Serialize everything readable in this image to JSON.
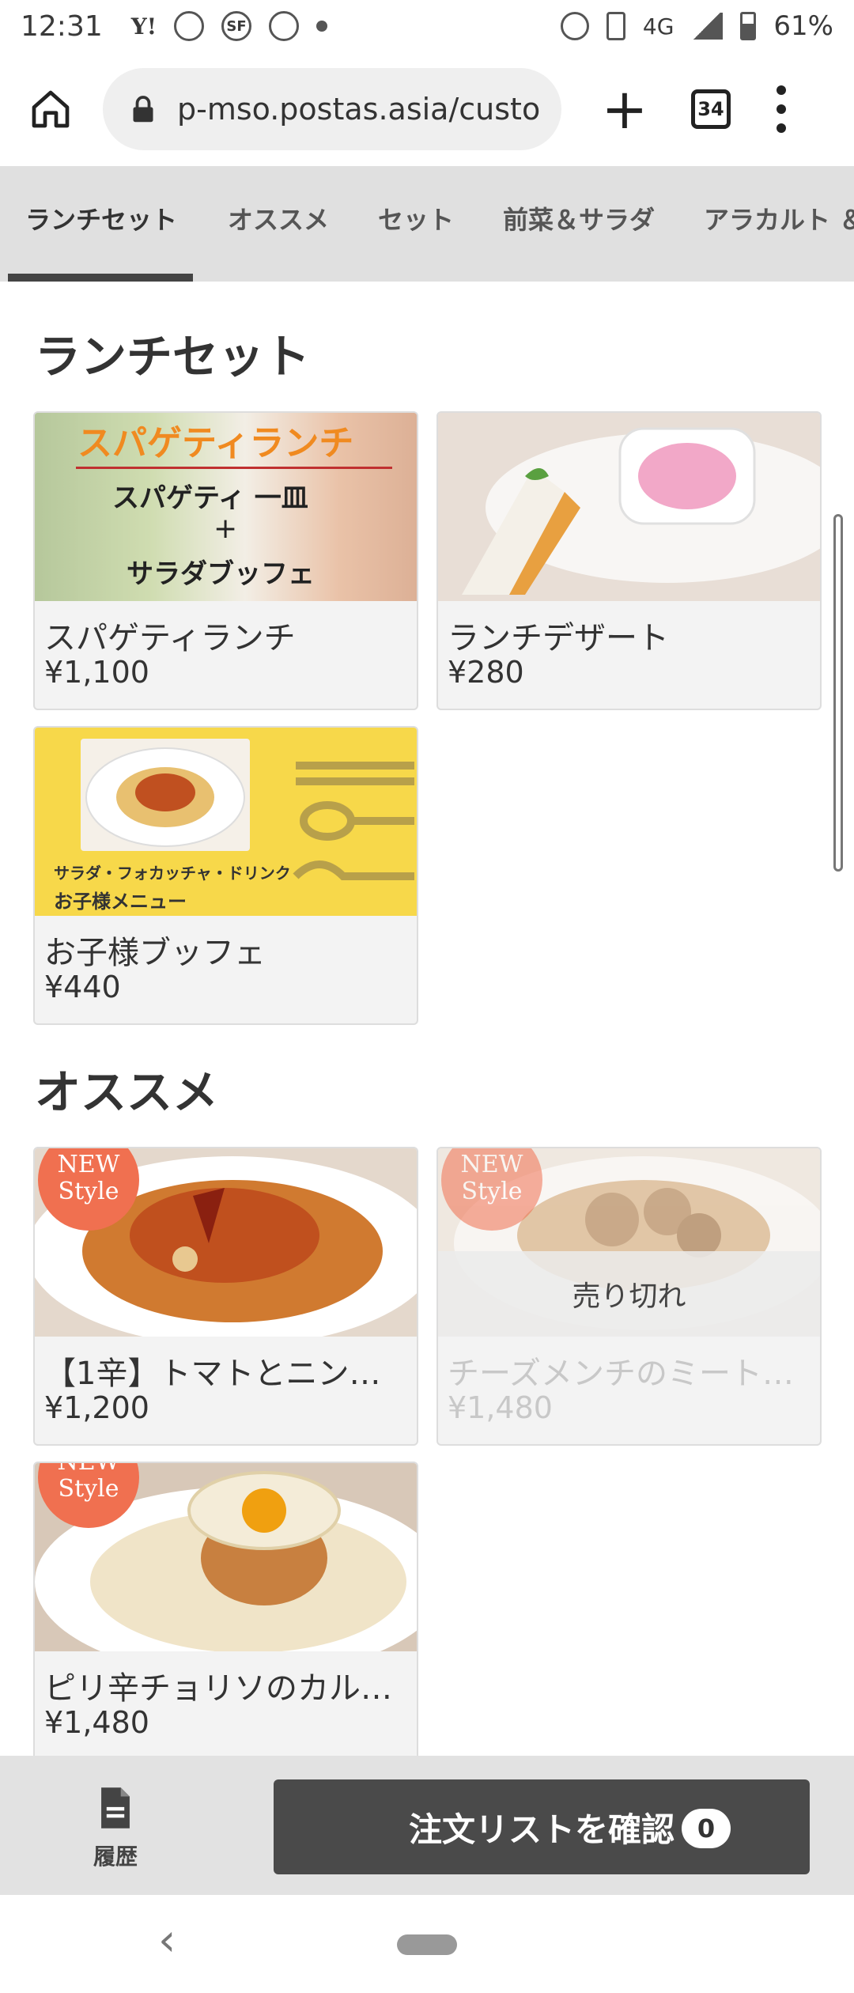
{
  "status_bar": {
    "time": "12:31",
    "notifications": [
      "Y!",
      "SF"
    ],
    "network": "4G",
    "battery": "61%"
  },
  "browser": {
    "url": "p-mso.postas.asia/custo",
    "tab_count": "34"
  },
  "category_tabs": [
    "ランチセット",
    "オススメ",
    "セット",
    "前菜＆サラダ",
    "アラカルト ＆"
  ],
  "sections": [
    {
      "title": "ランチセット",
      "items": [
        {
          "name": "スパゲティランチ",
          "price": "¥1,100",
          "image_text": [
            "スパゲティランチ",
            "スパゲティ 一皿",
            "+",
            "サラダブッフェ"
          ]
        },
        {
          "name": "ランチデザート",
          "price": "¥280"
        },
        {
          "name": "お子様ブッフェ",
          "price": "¥440",
          "image_text": [
            "サラダ・フォカッチャ・ドリンク",
            "お子様メニュー"
          ]
        }
      ]
    },
    {
      "title": "オススメ",
      "items": [
        {
          "name": "【1辛】トマトとニンニ…",
          "price": "¥1,200",
          "badge": [
            "NEW",
            "Style"
          ]
        },
        {
          "name": "チーズメンチのミート…",
          "price": "¥1,480",
          "badge": [
            "NEW",
            "Style"
          ],
          "soldout_label": "売り切れ"
        },
        {
          "name": "ピリ辛チョリソのカル…",
          "price": "¥1,480",
          "badge": [
            "NEW",
            "Style"
          ]
        }
      ]
    }
  ],
  "bottom_bar": {
    "history_label": "履歴",
    "order_label": "注文リストを確認",
    "order_count": "0"
  },
  "colors": {
    "tab_bar_bg": "#e0e0e0",
    "order_button": "#4a4a4a",
    "badge": "#f07050",
    "card_bg": "#f3f3f3"
  }
}
